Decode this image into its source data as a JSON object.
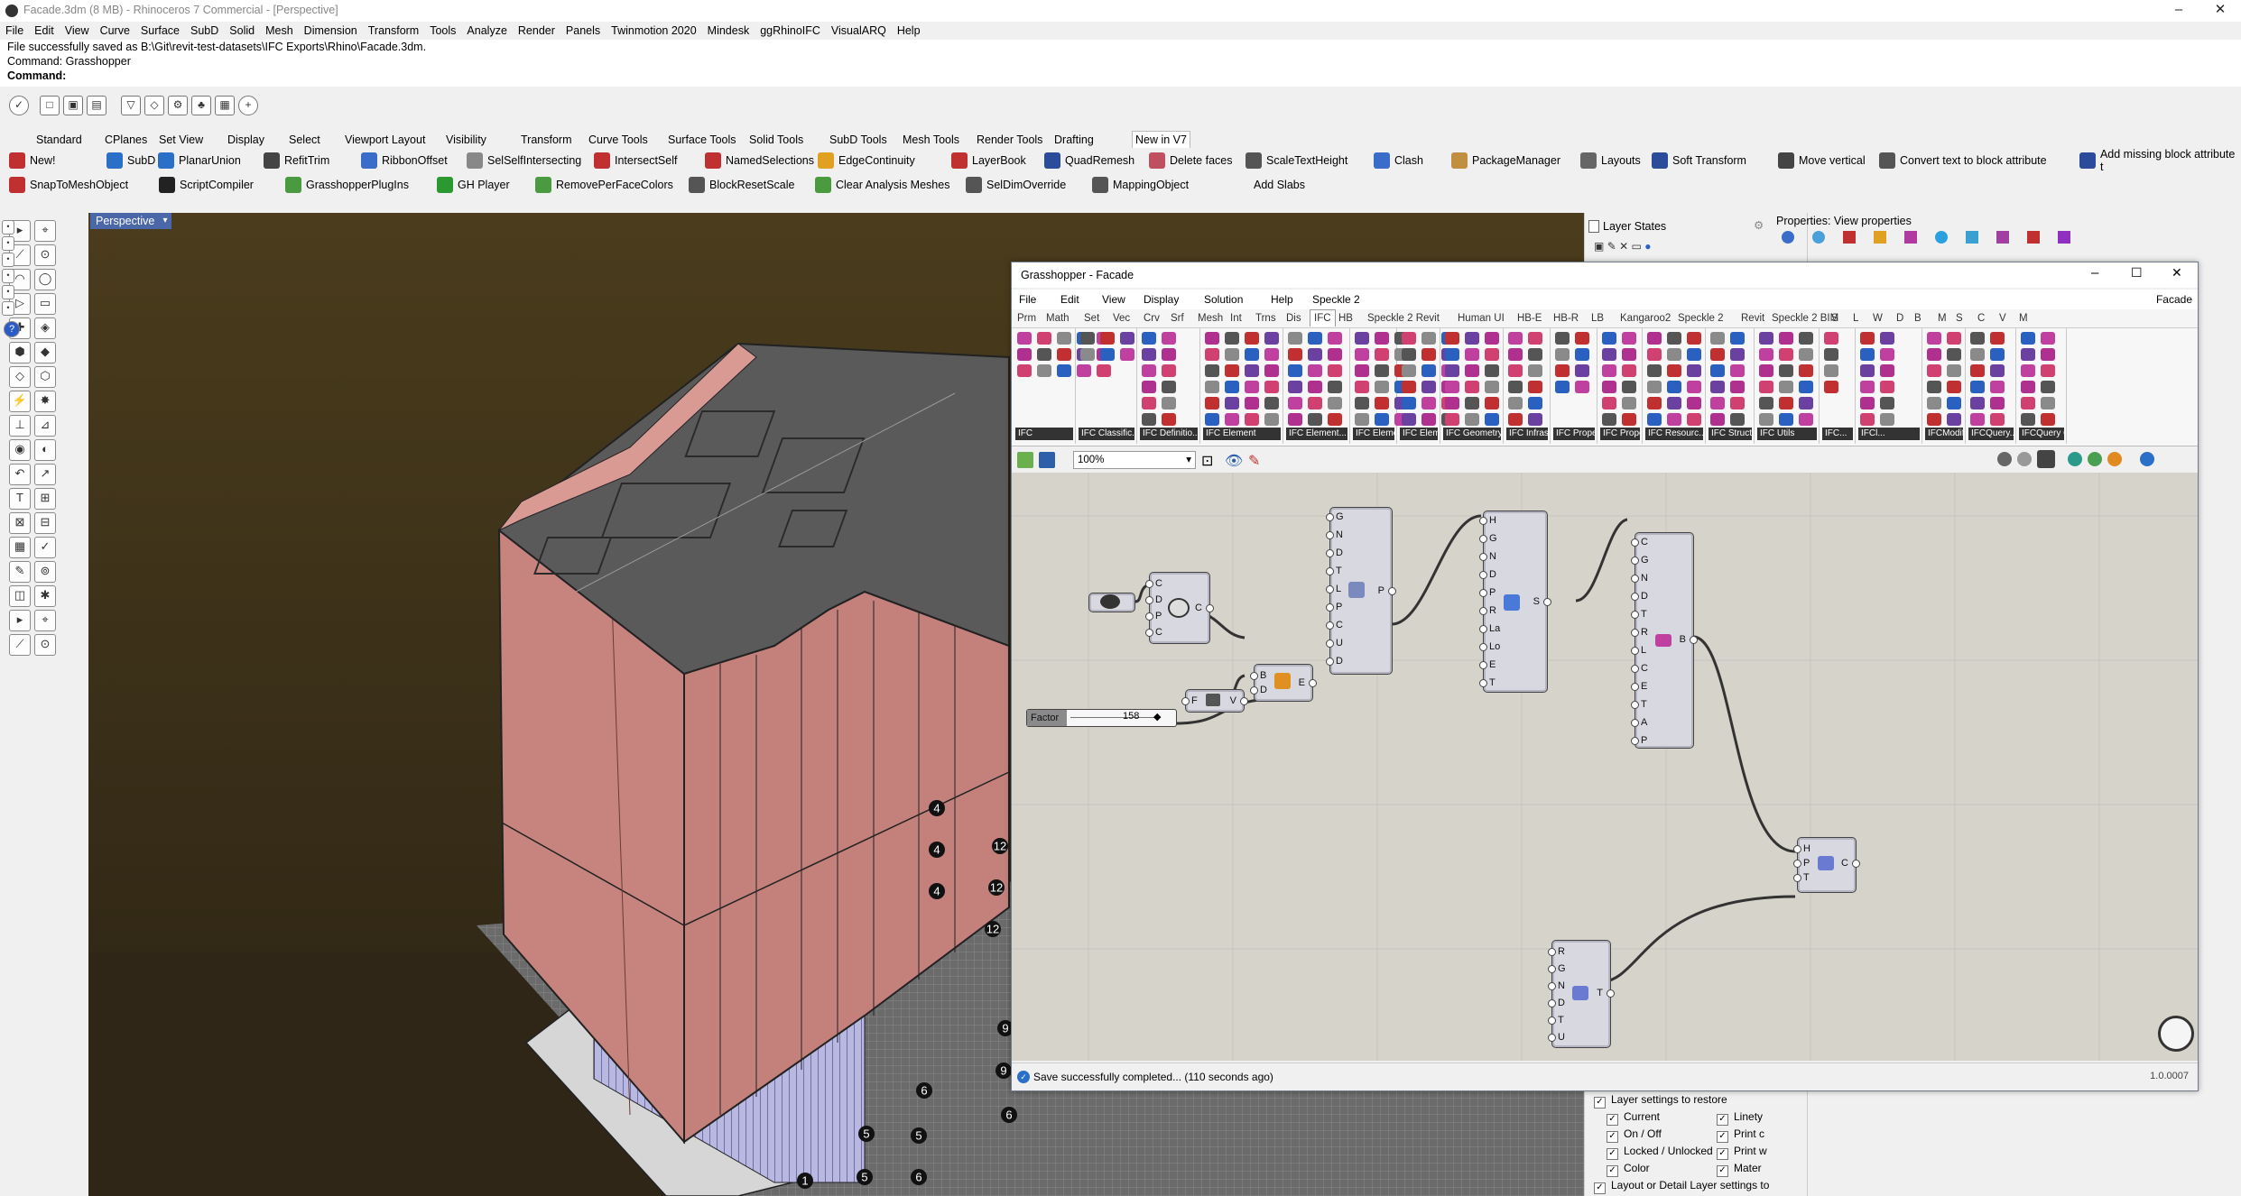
{
  "window": {
    "title": "Facade.3dm (8 MB) - Rhinoceros 7 Commercial - [Perspective]"
  },
  "menubar": [
    "File",
    "Edit",
    "View",
    "Curve",
    "Surface",
    "SubD",
    "Solid",
    "Mesh",
    "Dimension",
    "Transform",
    "Tools",
    "Analyze",
    "Render",
    "Panels",
    "Twinmotion 2020",
    "Mindesk",
    "ggRhinoIFC",
    "VisualARQ",
    "Help"
  ],
  "command": {
    "history_line": "File successfully saved as B:\\Git\\revit-test-datasets\\IFC Exports\\Rhino\\Facade.3dm.",
    "last_command": "Command: Grasshopper",
    "prompt_label": "Command:"
  },
  "toolbar_tabs": [
    "Standard",
    "CPlanes",
    "Set View",
    "Display",
    "Select",
    "Viewport Layout",
    "Visibility",
    "Transform",
    "Curve Tools",
    "Surface Tools",
    "Solid Tools",
    "SubD Tools",
    "Mesh Tools",
    "Render Tools",
    "Drafting",
    "New in V7"
  ],
  "command_row1": [
    "New!",
    "SubD",
    "PlanarUnion",
    "RefitTrim",
    "RibbonOffset",
    "SelSelfIntersecting",
    "IntersectSelf",
    "NamedSelections",
    "EdgeContinuity",
    "LayerBook",
    "QuadRemesh",
    "Delete faces",
    "ScaleTextHeight",
    "Clash",
    "PackageManager",
    "Layouts",
    "Soft Transform",
    "Move vertical",
    "Convert text to block attribute",
    "Add missing block attribute t"
  ],
  "command_row2": [
    "SnapToMeshObject",
    "ScriptCompiler",
    "GrasshopperPlugIns",
    "GH Player",
    "RemovePerFaceColors",
    "BlockResetScale",
    "Clear Analysis Meshes",
    "SelDimOverride",
    "MappingObject",
    "Add Slabs"
  ],
  "viewport": {
    "label": "Perspective",
    "dimension_tags": [
      "4",
      "4",
      "4",
      "12",
      "12",
      "12",
      "9",
      "9",
      "6",
      "6",
      "5",
      "5",
      "1",
      "5",
      "6"
    ]
  },
  "layer_states": {
    "title": "Layer States",
    "restore_label": "Layer settings to restore",
    "options_left": [
      "Current",
      "On / Off",
      "Locked / Unlocked",
      "Color",
      "Layout or Detail Layer settings to"
    ],
    "options_right": [
      "Linety",
      "Print c",
      "Print w",
      "Mater"
    ]
  },
  "properties": {
    "title": "Properties: View properties"
  },
  "grasshopper": {
    "title": "Grasshopper - Facade",
    "menu": [
      "File",
      "Edit",
      "View",
      "Display",
      "Solution",
      "Help",
      "Speckle 2"
    ],
    "doc_name": "Facade",
    "tabs": [
      "Prm",
      "Math",
      "Set",
      "Vec",
      "Crv",
      "Srf",
      "Mesh",
      "Int",
      "Trns",
      "Dis",
      "IFC",
      "HB",
      "Speckle 2 Revit",
      "Human UI",
      "HB-E",
      "HB-R",
      "LB",
      "Kangaroo2",
      "Speckle 2",
      "Revit",
      "Speckle 2 BIM",
      "S",
      "L",
      "W",
      "D",
      "B",
      "M",
      "S",
      "C",
      "V",
      "M"
    ],
    "active_tab": "IFC",
    "ribbon_groups": [
      "IFC",
      "IFC Classific...",
      "IFC Definitio...",
      "IFC Element",
      "IFC Element...",
      "IFC Element...",
      "IFC Element...",
      "IFC Geometry",
      "IFC Infrast...",
      "IFC Proper...",
      "IFC Properti...",
      "IFC Resourc...",
      "IFC StructAn...",
      "IFC Utils",
      "IFC...",
      "IFCl...",
      "IFCModify",
      "IFCQuery...",
      "IFCQuery Ot..."
    ],
    "zoom": "100%",
    "slider": {
      "label": "Factor",
      "value": "158"
    },
    "components": {
      "c1_inputs": [
        "C",
        "D",
        "P",
        "C"
      ],
      "c1_output": "C",
      "c2_inputs": [
        "B",
        "D"
      ],
      "c2_output": "E",
      "c3_inputs": [
        "F"
      ],
      "c3_output": "V",
      "c4_inputs": [
        "G",
        "N",
        "D",
        "T",
        "L",
        "P",
        "C",
        "U",
        "D"
      ],
      "c4_output": "P",
      "c5_inputs": [
        "H",
        "G",
        "N",
        "D",
        "P",
        "R",
        "La",
        "Lo",
        "E",
        "T"
      ],
      "c5_output": "S",
      "c6_inputs": [
        "C",
        "G",
        "N",
        "D",
        "T",
        "R",
        "L",
        "C",
        "E",
        "T",
        "A",
        "P"
      ],
      "c6_output": "B",
      "c7_inputs": [
        "H",
        "P",
        "T"
      ],
      "c7_output": "C",
      "c8_inputs": [
        "R",
        "G",
        "N",
        "D",
        "T",
        "U"
      ],
      "c8_output": "T"
    },
    "status": "Save successfully completed... (110 seconds ago)",
    "version": "1.0.0007"
  },
  "colors": {
    "accent_blue": "#4a67a8",
    "facade_pink": "#c98a86",
    "ground_dark": "#332a18",
    "canvas": "#d6d3cb"
  }
}
